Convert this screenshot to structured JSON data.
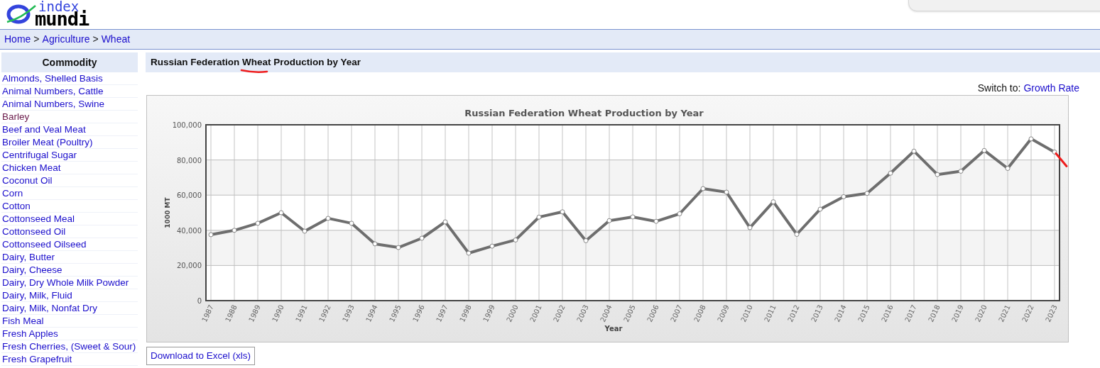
{
  "logo": {
    "top": "index",
    "bottom": "mundi"
  },
  "breadcrumb": {
    "separator": ">",
    "items": [
      {
        "label": "Home"
      },
      {
        "label": "Agriculture"
      },
      {
        "label": "Wheat"
      }
    ]
  },
  "sidebar": {
    "title": "Commodity",
    "items": [
      {
        "label": "Almonds, Shelled Basis",
        "visited": false
      },
      {
        "label": "Animal Numbers, Cattle",
        "visited": false
      },
      {
        "label": "Animal Numbers, Swine",
        "visited": false
      },
      {
        "label": "Barley",
        "visited": true
      },
      {
        "label": "Beef and Veal Meat",
        "visited": false
      },
      {
        "label": "Broiler Meat (Poultry)",
        "visited": false
      },
      {
        "label": "Centrifugal Sugar",
        "visited": false
      },
      {
        "label": "Chicken Meat",
        "visited": false
      },
      {
        "label": "Coconut Oil",
        "visited": false
      },
      {
        "label": "Corn",
        "visited": false
      },
      {
        "label": "Cotton",
        "visited": false
      },
      {
        "label": "Cottonseed Meal",
        "visited": false
      },
      {
        "label": "Cottonseed Oil",
        "visited": false
      },
      {
        "label": "Cottonseed Oilseed",
        "visited": false
      },
      {
        "label": "Dairy, Butter",
        "visited": false
      },
      {
        "label": "Dairy, Cheese",
        "visited": false
      },
      {
        "label": "Dairy, Dry Whole Milk Powder",
        "visited": false
      },
      {
        "label": "Dairy, Milk, Fluid",
        "visited": false
      },
      {
        "label": "Dairy, Milk, Nonfat Dry",
        "visited": false
      },
      {
        "label": "Fish Meal",
        "visited": false
      },
      {
        "label": "Fresh Apples",
        "visited": false
      },
      {
        "label": "Fresh Cherries, (Sweet & Sour)",
        "visited": false
      },
      {
        "label": "Fresh Grapefruit",
        "visited": false
      }
    ]
  },
  "main": {
    "title": "Russian Federation Wheat Production by Year",
    "switch_label": "Switch to:",
    "switch_link": "Growth Rate",
    "download": "Download to Excel (xls)",
    "chart_data": {
      "type": "line",
      "title": "Russian Federation Wheat Production by Year",
      "xlabel": "Year",
      "ylabel": "1000 MT",
      "categories": [
        "1987",
        "1988",
        "1989",
        "1990",
        "1991",
        "1992",
        "1993",
        "1994",
        "1995",
        "1996",
        "1997",
        "1998",
        "1999",
        "2000",
        "2001",
        "2002",
        "2003",
        "2004",
        "2005",
        "2006",
        "2007",
        "2008",
        "2009",
        "2010",
        "2011",
        "2012",
        "2013",
        "2014",
        "2015",
        "2016",
        "2017",
        "2018",
        "2019",
        "2020",
        "2021",
        "2022",
        "2023"
      ],
      "grid": true,
      "series": [
        {
          "color": "#6e6e6e",
          "marker": true,
          "values": [
            37500,
            40000,
            44000,
            50000,
            39500,
            46800,
            44000,
            32300,
            30200,
            35500,
            44800,
            27000,
            31000,
            34500,
            47500,
            50500,
            34100,
            45500,
            47600,
            45100,
            49400,
            63700,
            61700,
            41500,
            56200,
            37700,
            52000,
            59100,
            61000,
            72500,
            85000,
            71700,
            73600,
            85400,
            75200,
            92000,
            84500
          ]
        }
      ],
      "ylim": [
        0,
        100000
      ],
      "yticks": [
        {
          "value": 0,
          "label": "0"
        },
        {
          "value": 20000,
          "label": "20,000"
        },
        {
          "value": 40000,
          "label": "40,000"
        },
        {
          "value": 60000,
          "label": "60,000"
        },
        {
          "value": 80000,
          "label": "80,000"
        },
        {
          "value": 100000,
          "label": "100,000"
        }
      ]
    }
  }
}
